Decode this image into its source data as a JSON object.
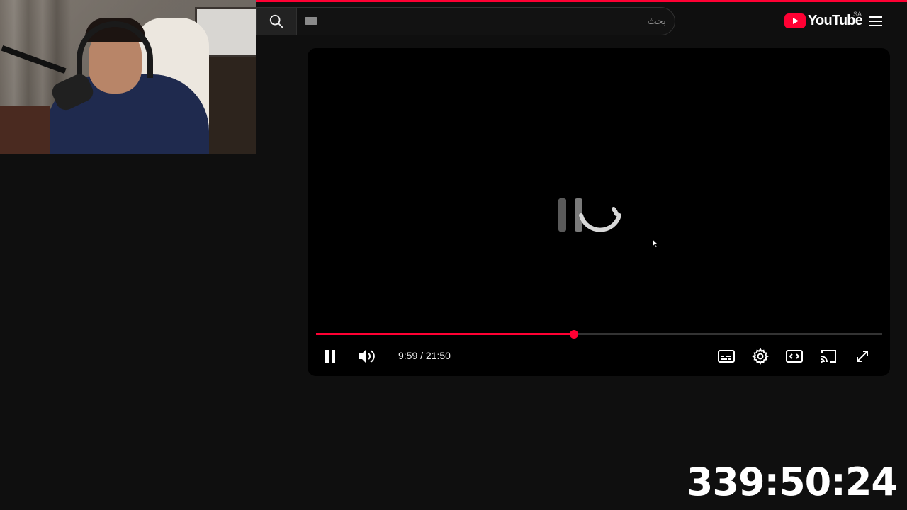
{
  "search": {
    "placeholder": "بحث"
  },
  "logo": {
    "wordmark": "YouTube",
    "country_code": "SA"
  },
  "player": {
    "state": "buffering",
    "progress_percent": 45.6,
    "time_current": "9:59",
    "time_total": "21:50",
    "time_separator": " / "
  },
  "stream_timer": "339:50:24",
  "icons": {
    "search": "search-icon",
    "keyboard": "keyboard-icon",
    "menu": "hamburger-menu-icon",
    "pause": "pause-icon",
    "volume": "volume-icon",
    "subtitles": "subtitles-icon",
    "settings": "gear-icon",
    "theater": "theater-mode-icon",
    "cast": "cast-icon",
    "fullscreen": "fullscreen-icon"
  },
  "colors": {
    "brand_red": "#ff0033",
    "background": "#0f0f0f"
  }
}
